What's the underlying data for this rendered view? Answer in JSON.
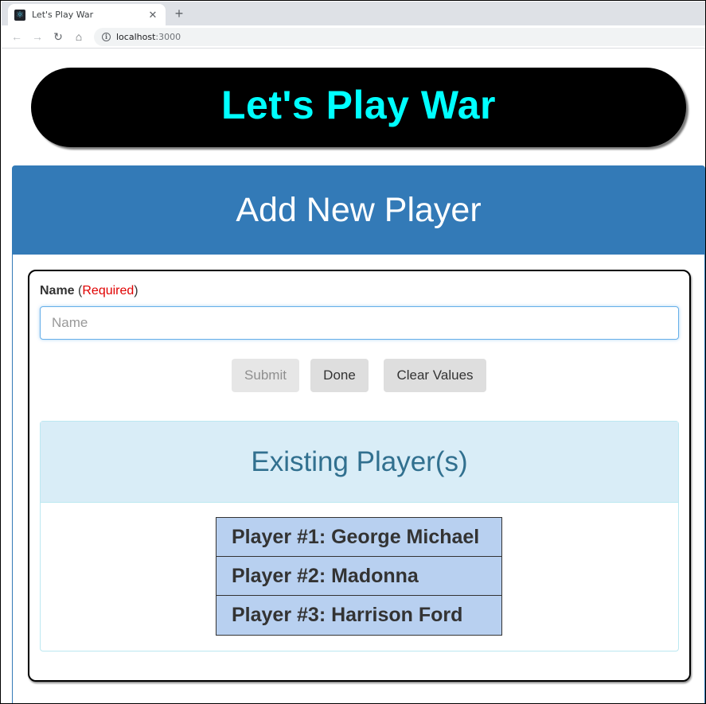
{
  "browser": {
    "tab_title": "Let's Play War",
    "tab_close_glyph": "✕",
    "new_tab_glyph": "+",
    "url_host": "localhost",
    "url_port": ":3000"
  },
  "banner": {
    "title": "Let's Play War",
    "title_color": "#00ffff",
    "background": "#000000"
  },
  "add_player": {
    "heading": "Add New Player",
    "heading_bg": "#337ab7",
    "name_label": "Name",
    "required_open": " (",
    "required_text": "Required",
    "required_close": ")",
    "name_placeholder": "Name",
    "name_value": "",
    "buttons": {
      "submit": "Submit",
      "done": "Done",
      "clear": "Clear Values"
    }
  },
  "existing_players": {
    "heading": "Existing Player(s)",
    "players": [
      "Player #1: George Michael",
      "Player #2: Madonna",
      "Player #3: Harrison Ford"
    ]
  }
}
